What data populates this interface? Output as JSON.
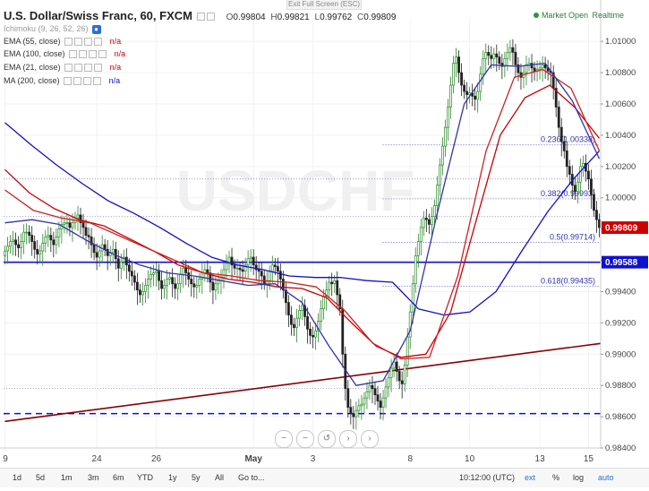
{
  "header": {
    "exit_fullscreen": "Exit Full Screen (ESC)",
    "symbol": "U.S. Dollar/Swiss Franc, 60, FXCM",
    "ohlc": {
      "o_label": "O",
      "o": "0.99804",
      "h_label": "H",
      "h": "0.99821",
      "l_label": "L",
      "l": "0.99762",
      "c_label": "C",
      "c": "0.99809"
    },
    "market_status": "Market Open",
    "realtime": "Realtime"
  },
  "indicators": [
    {
      "label": "Ichimoku (9, 26, 52, 26)",
      "value": "",
      "color": "#999999"
    },
    {
      "label": "EMA (55, close)",
      "value": "n/a",
      "color": "#cc0000"
    },
    {
      "label": "EMA (100, close)",
      "value": "n/a",
      "color": "#cc0000"
    },
    {
      "label": "EMA (21, close)",
      "value": "n/a",
      "color": "#cc0000"
    },
    {
      "label": "MA (200, close)",
      "value": "n/a",
      "color": "#1010cc"
    }
  ],
  "bottom_bar": {
    "ranges": [
      "1d",
      "5d",
      "1m",
      "3m",
      "6m",
      "YTD",
      "1y",
      "5y",
      "All"
    ],
    "goto": "Go to...",
    "clock": "10:12:00 (UTC)",
    "ext": "ext",
    "pct": "%",
    "log": "log",
    "auto": "auto"
  },
  "nav_buttons": [
    "−",
    "−",
    "↺",
    "›",
    "›"
  ],
  "chart_data": {
    "type": "candlestick",
    "watermark": "USDCHF",
    "y_axis": {
      "ylim": [
        0.984,
        1.0115
      ],
      "ticks": [
        "1.01000",
        "1.00800",
        "1.00600",
        "1.00400",
        "1.00200",
        "1.00000",
        "0.99800",
        "0.99600",
        "0.99400",
        "0.99200",
        "0.99000",
        "0.98800",
        "0.98600",
        "0.98400"
      ],
      "tick_values": [
        1.01,
        1.008,
        1.006,
        1.004,
        1.002,
        1.0,
        0.998,
        0.996,
        0.994,
        0.992,
        0.99,
        0.988,
        0.986,
        0.984
      ]
    },
    "x_axis": {
      "labels": [
        "9",
        "24",
        "26",
        "May",
        "3",
        "8",
        "10",
        "13",
        "15"
      ],
      "label_bars": [
        0,
        34,
        56,
        92,
        114,
        150,
        172,
        198,
        216
      ]
    },
    "last_price": {
      "value": "0.99809",
      "color": "#cc0000"
    },
    "horizontal_line": {
      "value": 0.99588,
      "label": "0.99588",
      "color": "#1010cc"
    },
    "dashed_line": {
      "value": 0.9862,
      "color": "#1010cc"
    },
    "fib_levels": [
      {
        "label": "0.236(1.00338)",
        "value": 1.00338
      },
      {
        "label": "0.382(0.99993)",
        "value": 0.99993
      },
      {
        "label": "0.5(0.99714)",
        "value": 0.99714
      },
      {
        "label": "0.618(0.99435)",
        "value": 0.99435
      }
    ],
    "dotted_levels": [
      1.0012,
      0.9988,
      0.9878
    ],
    "trendline": {
      "from": [
        0,
        0.9857
      ],
      "to": [
        225,
        0.9908
      ],
      "color": "#8b0000"
    },
    "closes": [
      0.9966,
      0.9969,
      0.9972,
      0.9973,
      0.997,
      0.9968,
      0.9972,
      0.9978,
      0.9978,
      0.9976,
      0.9972,
      0.9967,
      0.9964,
      0.9966,
      0.9971,
      0.9975,
      0.9976,
      0.9973,
      0.997,
      0.9975,
      0.998,
      0.9983,
      0.9984,
      0.9984,
      0.9981,
      0.9984,
      0.9987,
      0.9989,
      0.9984,
      0.9981,
      0.9976,
      0.9975,
      0.997,
      0.9965,
      0.9962,
      0.9966,
      0.997,
      0.9967,
      0.9963,
      0.9965,
      0.9967,
      0.9961,
      0.9955,
      0.9959,
      0.9962,
      0.9957,
      0.9953,
      0.995,
      0.9946,
      0.9941,
      0.9938,
      0.994,
      0.9944,
      0.9948,
      0.9951,
      0.9952,
      0.9953,
      0.9947,
      0.9942,
      0.9944,
      0.9948,
      0.9949,
      0.9945,
      0.9942,
      0.9945,
      0.9951,
      0.9955,
      0.9952,
      0.9948,
      0.9945,
      0.9943,
      0.9944,
      0.9948,
      0.9952,
      0.9954,
      0.9952,
      0.9946,
      0.9941,
      0.9945,
      0.9947,
      0.9949,
      0.9954,
      0.9958,
      0.9962,
      0.9957,
      0.9955,
      0.9955,
      0.9954,
      0.9953,
      0.9957,
      0.9961,
      0.9962,
      0.9957,
      0.9954,
      0.9953,
      0.995,
      0.9945,
      0.9947,
      0.9953,
      0.9957,
      0.9956,
      0.9953,
      0.9948,
      0.9941,
      0.9933,
      0.9925,
      0.9919,
      0.9917,
      0.9923,
      0.9928,
      0.9931,
      0.9924,
      0.9916,
      0.9912,
      0.9911,
      0.9915,
      0.9921,
      0.9929,
      0.9937,
      0.9941,
      0.9946,
      0.9945,
      0.9947,
      0.9938,
      0.9929,
      0.99,
      0.9878,
      0.9866,
      0.9862,
      0.986,
      0.9864,
      0.9867,
      0.9868,
      0.9872,
      0.9876,
      0.988,
      0.9878,
      0.9874,
      0.987,
      0.9866,
      0.9872,
      0.9879,
      0.9885,
      0.9891,
      0.9895,
      0.9889,
      0.9883,
      0.9881,
      0.9893,
      0.9911,
      0.9927,
      0.9945,
      0.9963,
      0.9972,
      0.9981,
      0.9987,
      0.9986,
      0.9983,
      0.9988,
      0.9995,
      1.0008,
      1.0021,
      1.0033,
      1.0045,
      1.0058,
      1.0072,
      1.0086,
      1.009,
      1.008,
      1.0072,
      1.0068,
      1.0066,
      1.0067,
      1.0065,
      1.0063,
      1.0068,
      1.0079,
      1.0089,
      1.0093,
      1.0091,
      1.0089,
      1.0092,
      1.009,
      1.0086,
      1.0084,
      1.0089,
      1.0093,
      1.0096,
      1.0093,
      1.0085,
      1.008,
      1.0077,
      1.008,
      1.0085,
      1.0086,
      1.0083,
      1.0081,
      1.0082,
      1.0083,
      1.0085,
      1.0083,
      1.0081,
      1.008,
      1.007,
      1.0058,
      1.0045,
      1.0036,
      1.003,
      1.002,
      1.0015,
      1.0008,
      1.0004,
      1.001,
      1.002,
      1.0022,
      1.0017,
      1.0012,
      1.0002,
      0.9992,
      0.9986,
      0.9981
    ],
    "ma200": [
      1.0048,
      1.0034,
      1.0021,
      1.0009,
      0.9998,
      0.999,
      0.9981,
      0.9971,
      0.9962,
      0.9957,
      0.9954,
      0.995,
      0.9949,
      0.9949,
      0.9947,
      0.9946,
      0.9929,
      0.9925,
      0.9927,
      0.994,
      0.9966,
      0.9991,
      1.0012,
      1.003
    ],
    "ema100": [
      1.0018,
      1.0003,
      0.9993,
      0.9986,
      0.9982,
      0.9974,
      0.9966,
      0.9957,
      0.9952,
      0.9948,
      0.9946,
      0.9943,
      0.9942,
      0.9936,
      0.992,
      0.9905,
      0.9898,
      0.99,
      0.9927,
      0.9984,
      1.004,
      1.0064,
      1.0072,
      1.0058,
      1.0038
    ],
    "ema55": [
      1.0005,
      0.9992,
      0.9987,
      0.9984,
      0.9976,
      0.9968,
      0.996,
      0.9952,
      0.995,
      0.9947,
      0.9946,
      0.9943,
      0.9928,
      0.9907,
      0.9897,
      0.9898,
      0.995,
      1.003,
      1.0077,
      1.0082,
      1.007,
      1.003
    ],
    "ema21": [
      0.9984,
      0.9986,
      0.9983,
      0.9973,
      0.9964,
      0.9957,
      0.9952,
      0.995,
      0.9947,
      0.9944,
      0.9945,
      0.9933,
      0.9905,
      0.988,
      0.9883,
      0.9915,
      0.999,
      1.006,
      1.0085,
      1.0084,
      1.0086,
      1.0062,
      1.0025
    ]
  }
}
